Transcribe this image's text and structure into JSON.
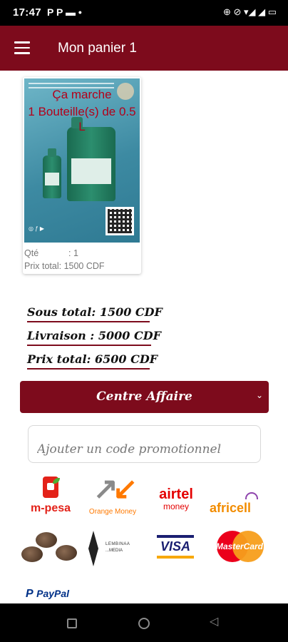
{
  "status_bar": {
    "time": "17:47",
    "notifications": "P  P  ▬  •",
    "system_icons": "⊕ ⊘ ▾◢ ◢ ▭"
  },
  "app_bar": {
    "menu_icon": "hamburger-menu-icon",
    "title": "Mon panier 1"
  },
  "cart_item": {
    "overlay_line1": "Ça marche",
    "overlay_line2": "1 Bouteille(s) de 0.5 L",
    "qty_label": "Qté",
    "qty_value": ": 1",
    "total_label": "Prix total: 1500 CDF"
  },
  "summary": {
    "subtotal": "Sous total: 1500 CDF",
    "delivery": "Livraison  : 5000 CDF",
    "total": "Prix total: 6500 CDF"
  },
  "delivery_select": {
    "selected": "Centre Affaire"
  },
  "promo": {
    "placeholder": "Ajouter un code promotionnel"
  },
  "payment_logos": {
    "mpesa": "m-pesa",
    "orange": "Orange Money",
    "airtel": "airtel",
    "airtel_sub": "money",
    "africell": "africell",
    "lembana_1": "LEMBINAA",
    "lembana_2": "...MEDIA",
    "visa": "VISA",
    "mastercard": "MasterCard",
    "paypal": "PayPal"
  },
  "colors": {
    "primary": "#7d0b1c",
    "overlay_text": "#b3001a"
  }
}
